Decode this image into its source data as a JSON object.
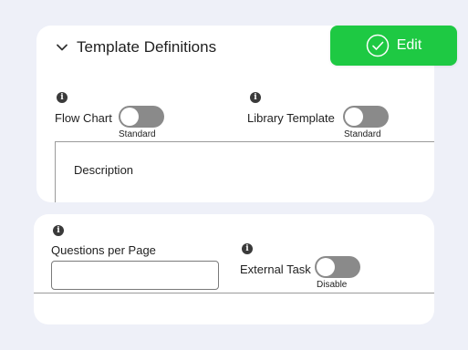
{
  "section": {
    "title": "Template Definitions"
  },
  "edit_button": {
    "label": "Edit"
  },
  "fields": {
    "flow_chart": {
      "label": "Flow Chart",
      "toggle_state": "Standard"
    },
    "library_template": {
      "label": "Library Template",
      "toggle_state": "Standard"
    },
    "description": {
      "label": "Description"
    },
    "questions_per_page": {
      "label": "Questions per Page",
      "value": ""
    },
    "external_task": {
      "label": "External Task",
      "toggle_state": "Disable"
    }
  },
  "colors": {
    "background": "#eef0f8",
    "card": "#ffffff",
    "edit_button": "#1ec943",
    "toggle_off": "#8a8a8a"
  },
  "icons": {
    "chevron": "chevron-down-icon",
    "edit": "check-circle-icon",
    "info": "info-icon"
  }
}
